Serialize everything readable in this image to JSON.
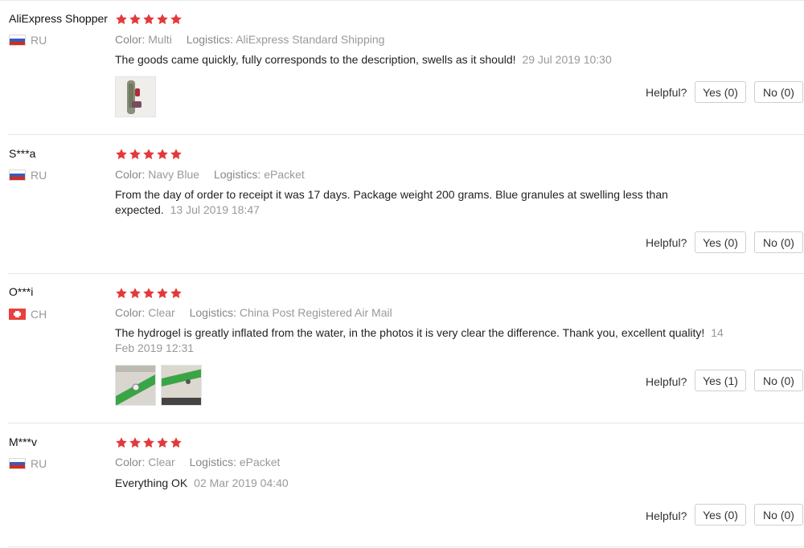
{
  "reviews": [
    {
      "user": "AliExpress Shopper",
      "country": "RU",
      "rating": 5,
      "color_label": "Color:",
      "color": "Multi",
      "logistics_label": "Logistics:",
      "logistics": "AliExpress Standard Shipping",
      "text": "The goods came quickly, fully corresponds to the description, swells as it should!",
      "date": "29 Jul 2019 10:30",
      "helpful_label": "Helpful?",
      "yes_label": "Yes (0)",
      "no_label": "No (0)"
    },
    {
      "user": "S***a",
      "country": "RU",
      "rating": 5,
      "color_label": "Color:",
      "color": "Navy Blue",
      "logistics_label": "Logistics:",
      "logistics": "ePacket",
      "text": "From the day of order to receipt it was 17 days. Package weight 200 grams. Blue granules at swelling less than expected.",
      "date": "13 Jul 2019 18:47",
      "helpful_label": "Helpful?",
      "yes_label": "Yes (0)",
      "no_label": "No (0)"
    },
    {
      "user": "O***i",
      "country": "CH",
      "rating": 5,
      "color_label": "Color:",
      "color": "Clear",
      "logistics_label": "Logistics:",
      "logistics": "China Post Registered Air Mail",
      "text": "The hydrogel is greatly inflated from the water, in the photos it is very clear the difference. Thank you, excellent quality!",
      "date": "14 Feb 2019 12:31",
      "helpful_label": "Helpful?",
      "yes_label": "Yes (1)",
      "no_label": "No (0)"
    },
    {
      "user": "M***v",
      "country": "RU",
      "rating": 5,
      "color_label": "Color:",
      "color": "Clear",
      "logistics_label": "Logistics:",
      "logistics": "ePacket",
      "text": "Everything OK",
      "date": "02 Mar 2019 04:40",
      "helpful_label": "Helpful?",
      "yes_label": "Yes (0)",
      "no_label": "No (0)"
    }
  ],
  "colors": {
    "star": "#e4393c",
    "muted_text": "#999999",
    "divider": "#e6e6e6",
    "button_border": "#cfcfcf"
  },
  "icons": {
    "star": "star-icon",
    "flag_ru": "russia-flag-icon",
    "flag_ch": "switzerland-flag-icon"
  }
}
